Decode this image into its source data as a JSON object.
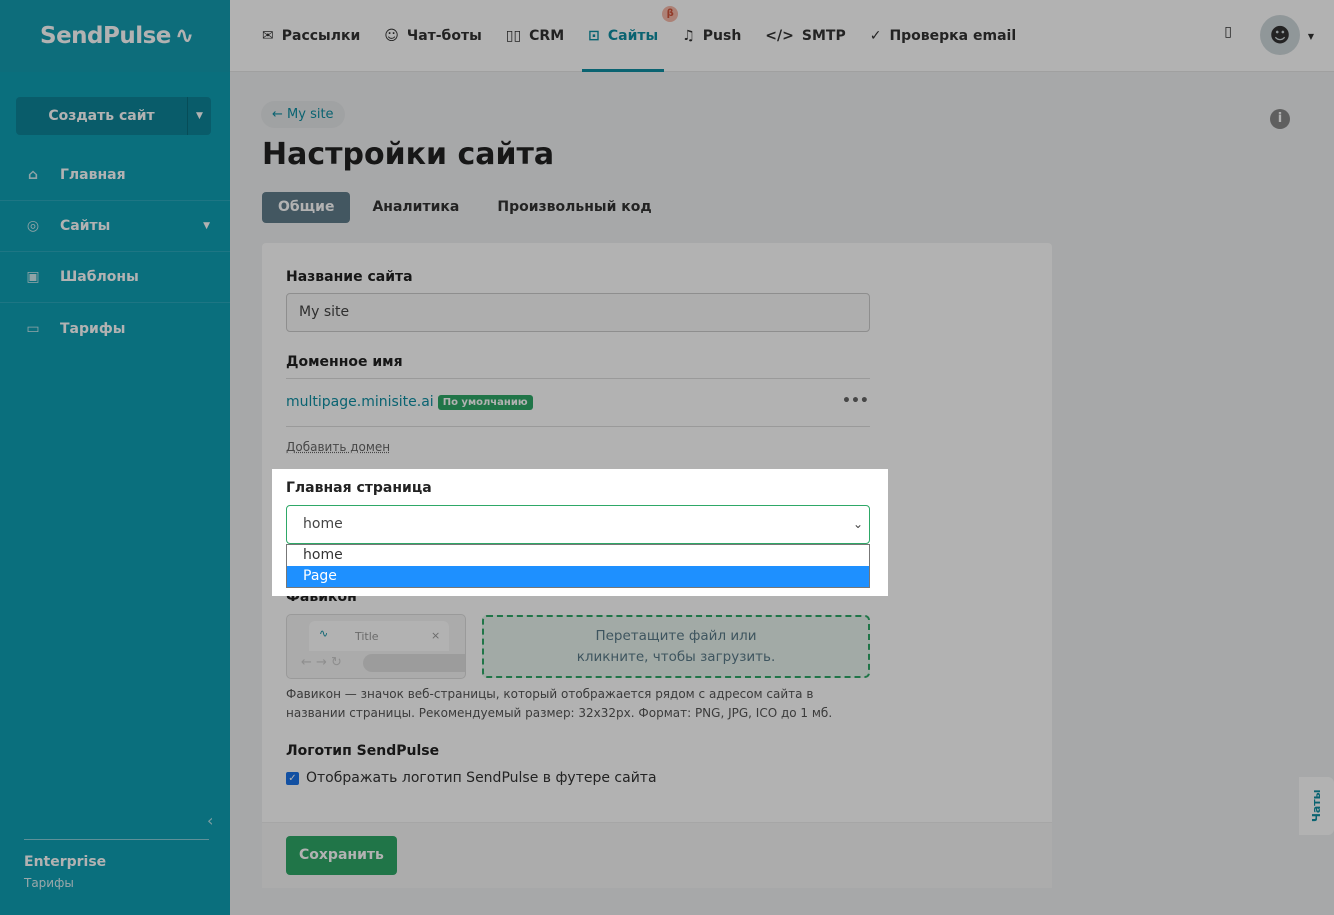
{
  "sidebar": {
    "logo": "SendPulse",
    "create_label": "Создать сайт",
    "items": [
      {
        "label": "Главная"
      },
      {
        "label": "Сайты"
      },
      {
        "label": "Шаблоны"
      },
      {
        "label": "Тарифы"
      }
    ],
    "plan_name": "Enterprise",
    "plan_link": "Тарифы"
  },
  "topnav": {
    "items": [
      {
        "label": "Рассылки"
      },
      {
        "label": "Чат-боты"
      },
      {
        "label": "CRM"
      },
      {
        "label": "Сайты"
      },
      {
        "label": "Push"
      },
      {
        "label": "SMTP"
      },
      {
        "label": "Проверка email"
      }
    ],
    "beta": "β"
  },
  "page": {
    "back": "← My site",
    "title": "Настройки сайта",
    "tabs": [
      "Общие",
      "Аналитика",
      "Произвольный код"
    ]
  },
  "form": {
    "site_name_label": "Название сайта",
    "site_name_value": "My site",
    "domain_label": "Доменное имя",
    "domain": "multipage.minisite.ai",
    "domain_badge": "По умолчанию",
    "add_domain": "Добавить домен",
    "home_label": "Главная страница",
    "home_value": "home",
    "home_options": [
      "home",
      "Page"
    ],
    "favicon_label": "Фавикон",
    "favicon_tab_title": "Title",
    "drop_line1": "Перетащите файл или",
    "drop_line2": "кликните, чтобы загрузить.",
    "favicon_help": "Фавикон — значок веб-страницы, который отображается рядом с адресом сайта в названии страницы. Рекомендуемый размер: 32x32px. Формат: PNG, JPG, ICO до 1 мб.",
    "logo_label": "Логотип SendPulse",
    "logo_checkbox": "Отображать логотип SendPulse в футере сайта",
    "save": "Сохранить"
  },
  "chats": "Чаты"
}
